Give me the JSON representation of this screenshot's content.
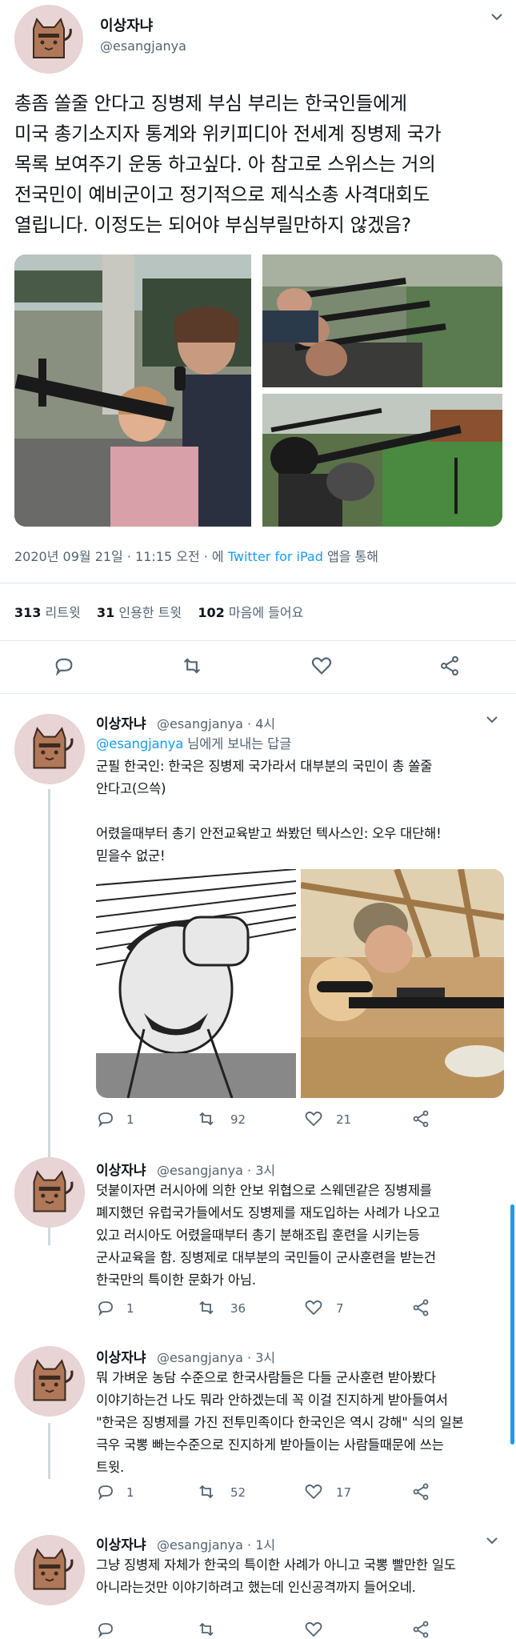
{
  "main_tweet": {
    "name": "이상자냐",
    "handle": "@esangjanya",
    "text_lines": [
      "총좀 쏠줄 안다고 징병제 부심 부리는 한국인들에게",
      "미국 총기소지자 통계와 위키피디아 전세계 징병제 국가",
      "목록 보여주기 운동 하고싶다. 아 참고로 스위스는 거의",
      "전국민이 예비군이고 정기적으로 제식소총 사격대회도",
      "열립니다. 이정도는 되어야 부심부릴만하지 않겠음?"
    ],
    "date": "2020년 09월 21일 · 11:15 오전 · 에",
    "client": "Twitter for iPad",
    "client_suffix": "앱을 통해",
    "stats": {
      "retweets": "313",
      "retweets_label": "리트윗",
      "quotes": "31",
      "quotes_label": "인용한 트윗",
      "likes": "102",
      "likes_label": "마음에 들어요"
    }
  },
  "replies": [
    {
      "name": "이상자냐",
      "handle_time": "@esangjanya · 4시",
      "reply_to_handle": "@esangjanya",
      "reply_to_suffix": "님에게 보내는 답글",
      "lines": [
        "군필 한국인: 한국은 징병제 국가라서 대부분의 국민이 총 쏠줄",
        "안다고(으쓱)",
        "",
        "어렸을때부터 총기 안전교육받고 쏴봤던 텍사스인: 오우 대단해!",
        "믿을수 없군!"
      ],
      "replies": "1",
      "retweets": "92",
      "likes": "21"
    },
    {
      "name": "이상자냐",
      "handle_time": "@esangjanya · 3시",
      "lines": [
        "덧붙이자면 러시아에 의한 안보 위협으로 스웨덴같은 징병제를",
        "폐지했던 유럽국가들에서도 징병제를 재도입하는 사례가 나오고",
        "있고 러시아도 어렸을때부터 총기 분해조립 훈련을 시키는등",
        "군사교육을 함. 징병제로 대부분의 국민들이 군사훈련을 받는건",
        "한국만의 특이한 문화가 아님."
      ],
      "replies": "1",
      "retweets": "36",
      "likes": "7"
    },
    {
      "name": "이상자냐",
      "handle_time": "@esangjanya · 3시",
      "lines": [
        "뭐 가벼운 농담 수준으로 한국사람들은 다들 군사훈련 받아봤다",
        "이야기하는건 나도 뭐라 안하겠는데 꼭 이걸 진지하게 받아들여서",
        "\"한국은 징병제를 가진 전투민족이다 한국인은 역시 강해\" 식의 일본",
        "극우 국뽕 빠는수준으로 진지하게 받아들이는 사람들때문에 쓰는",
        "트윗."
      ],
      "replies": "1",
      "retweets": "52",
      "likes": "17"
    },
    {
      "name": "이상자냐",
      "handle_time": "@esangjanya · 1시",
      "lines": [
        "그냥 징병제 자체가 한국의 특이한 사례가 아니고 국뽕 빨만한 일도",
        "아니라는것만 이야기하려고 했는데 인신공격까지 들어오네."
      ],
      "replies": "",
      "retweets": "",
      "likes": ""
    }
  ],
  "colors": {
    "text": "#0f1419",
    "secondary": "#536471",
    "link": "#1d9bf0",
    "divider": "#e1e8ed",
    "avatar_bg": "#e8d4d4",
    "cat_body": "#b07858"
  }
}
